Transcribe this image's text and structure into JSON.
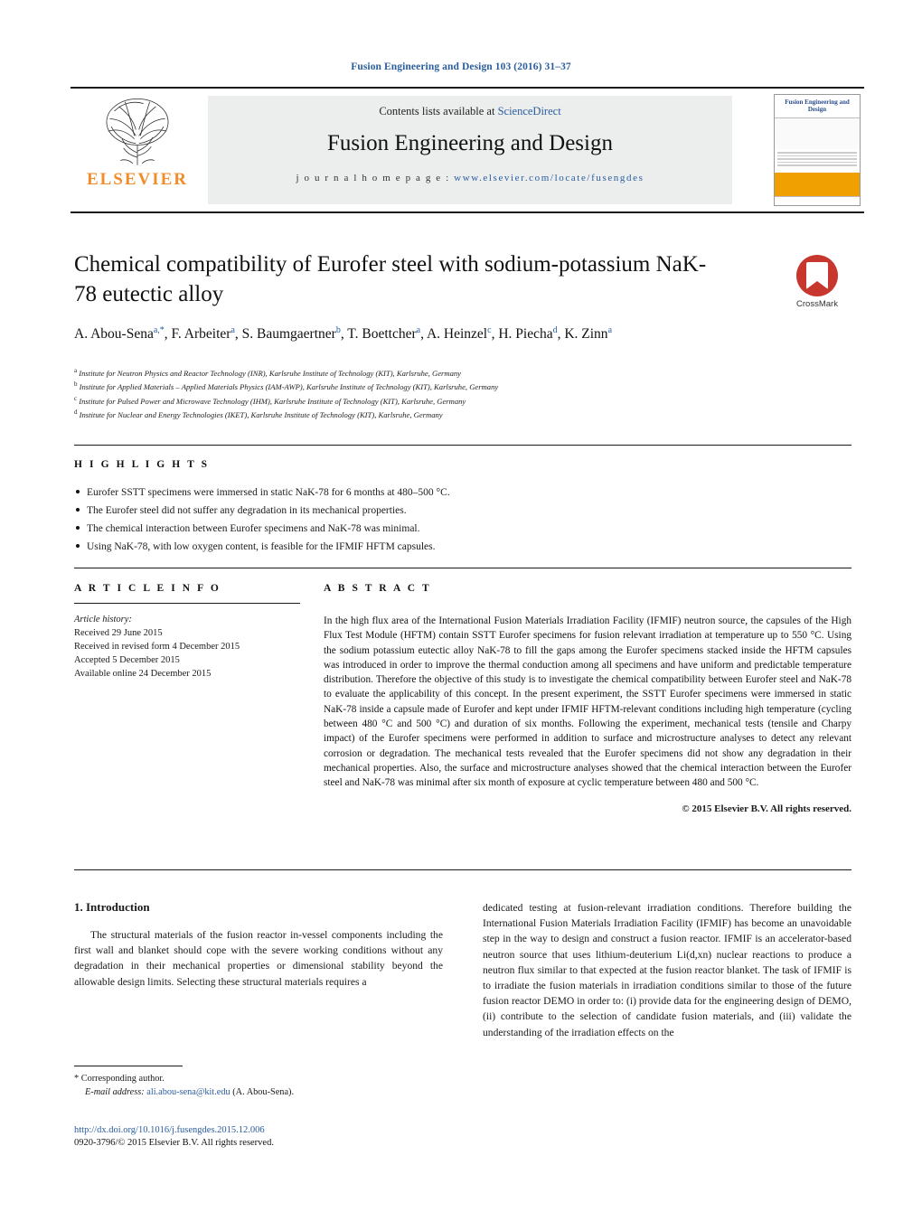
{
  "journal_header": "Fusion Engineering and Design 103 (2016) 31–37",
  "masthead": {
    "contents_prefix": "Contents lists available at ",
    "contents_link": "ScienceDirect",
    "journal_title": "Fusion Engineering and Design",
    "homepage_prefix": "j o u r n a l   h o m e p a g e :   ",
    "homepage_url": "www.elsevier.com/locate/fusengdes",
    "publisher": "ELSEVIER",
    "cover_title": "Fusion Engineering and Design"
  },
  "article": {
    "title": "Chemical compatibility of Eurofer steel with sodium-potassium NaK-78 eutectic alloy",
    "crossmark_label": "CrossMark",
    "authors_html": "A. Abou-Sena<sup>a,*</sup>, F. Arbeiter<sup>a</sup>, S. Baumgaertner<sup>b</sup>, T. Boettcher<sup>a</sup>, A. Heinzel<sup>c</sup>, H. Piecha<sup>d</sup>, K. Zinn<sup>a</sup>",
    "affiliations": [
      "a Institute for Neutron Physics and Reactor Technology (INR), Karlsruhe Institute of Technology (KIT), Karlsruhe, Germany",
      "b Institute for Applied Materials – Applied Materials Physics (IAM-AWP), Karlsruhe Institute of Technology (KIT), Karlsruhe, Germany",
      "c Institute for Pulsed Power and Microwave Technology (IHM), Karlsruhe Institute of Technology (KIT), Karlsruhe, Germany",
      "d Institute for Nuclear and Energy Technologies (IKET), Karlsruhe Institute of Technology (KIT), Karlsruhe, Germany"
    ]
  },
  "highlights": {
    "heading": "H I G H L I G H T S",
    "items": [
      "Eurofer SSTT specimens were immersed in static NaK-78 for 6 months at 480–500 °C.",
      "The Eurofer steel did not suffer any degradation in its mechanical properties.",
      "The chemical interaction between Eurofer specimens and NaK-78 was minimal.",
      "Using NaK-78, with low oxygen content, is feasible for the IFMIF HFTM capsules."
    ]
  },
  "article_info": {
    "heading": "A R T I C L E    I N F O",
    "history_label": "Article history:",
    "lines": [
      "Received 29 June 2015",
      "Received in revised form 4 December 2015",
      "Accepted 5 December 2015",
      "Available online 24 December 2015"
    ]
  },
  "abstract": {
    "heading": "A B S T R A C T",
    "text": "In the high flux area of the International Fusion Materials Irradiation Facility (IFMIF) neutron source, the capsules of the High Flux Test Module (HFTM) contain SSTT Eurofer specimens for fusion relevant irradiation at temperature up to 550 °C. Using the sodium potassium eutectic alloy NaK-78 to fill the gaps among the Eurofer specimens stacked inside the HFTM capsules was introduced in order to improve the thermal conduction among all specimens and have uniform and predictable temperature distribution. Therefore the objective of this study is to investigate the chemical compatibility between Eurofer steel and NaK-78 to evaluate the applicability of this concept. In the present experiment, the SSTT Eurofer specimens were immersed in static NaK-78 inside a capsule made of Eurofer and kept under IFMIF HFTM-relevant conditions including high temperature (cycling between 480 °C and 500 °C) and duration of six months. Following the experiment, mechanical tests (tensile and Charpy impact) of the Eurofer specimens were performed in addition to surface and microstructure analyses to detect any relevant corrosion or degradation. The mechanical tests revealed that the Eurofer specimens did not show any degradation in their mechanical properties. Also, the surface and microstructure analyses showed that the chemical interaction between the Eurofer steel and NaK-78 was minimal after six month of exposure at cyclic temperature between 480 and 500 °C.",
    "copyright": "© 2015 Elsevier B.V. All rights reserved."
  },
  "body": {
    "section_number_title": "1.   Introduction",
    "left_paragraph": "The structural materials of the fusion reactor in-vessel components including the first wall and blanket should cope with the severe working conditions without any degradation in their mechanical properties or dimensional stability beyond the allowable design limits. Selecting these structural materials requires a",
    "right_paragraph": "dedicated testing at fusion-relevant irradiation conditions. Therefore building the International Fusion Materials Irradiation Facility (IFMIF) has become an unavoidable step in the way to design and construct a fusion reactor. IFMIF is an accelerator-based neutron source that uses lithium-deuterium Li(d,xn) nuclear reactions to produce a neutron flux similar to that expected at the fusion reactor blanket. The task of IFMIF is to irradiate the fusion materials in irradiation conditions similar to those of the future fusion reactor DEMO in order to: (i) provide data for the engineering design of DEMO, (ii) contribute to the selection of candidate fusion materials, and (iii) validate the understanding of the irradiation effects on the"
  },
  "footer": {
    "corresponding_label": "*  Corresponding author.",
    "email_label": "E-mail address: ",
    "email": "ali.abou-sena@kit.edu",
    "email_suffix": " (A. Abou-Sena).",
    "doi_url": "http://dx.doi.org/10.1016/j.fusengdes.2015.12.006",
    "issn_line": "0920-3796/© 2015 Elsevier B.V. All rights reserved."
  },
  "colors": {
    "link": "#2a5d9e",
    "elsevier_orange": "#f28c28",
    "crossmark_red": "#c8372d"
  }
}
